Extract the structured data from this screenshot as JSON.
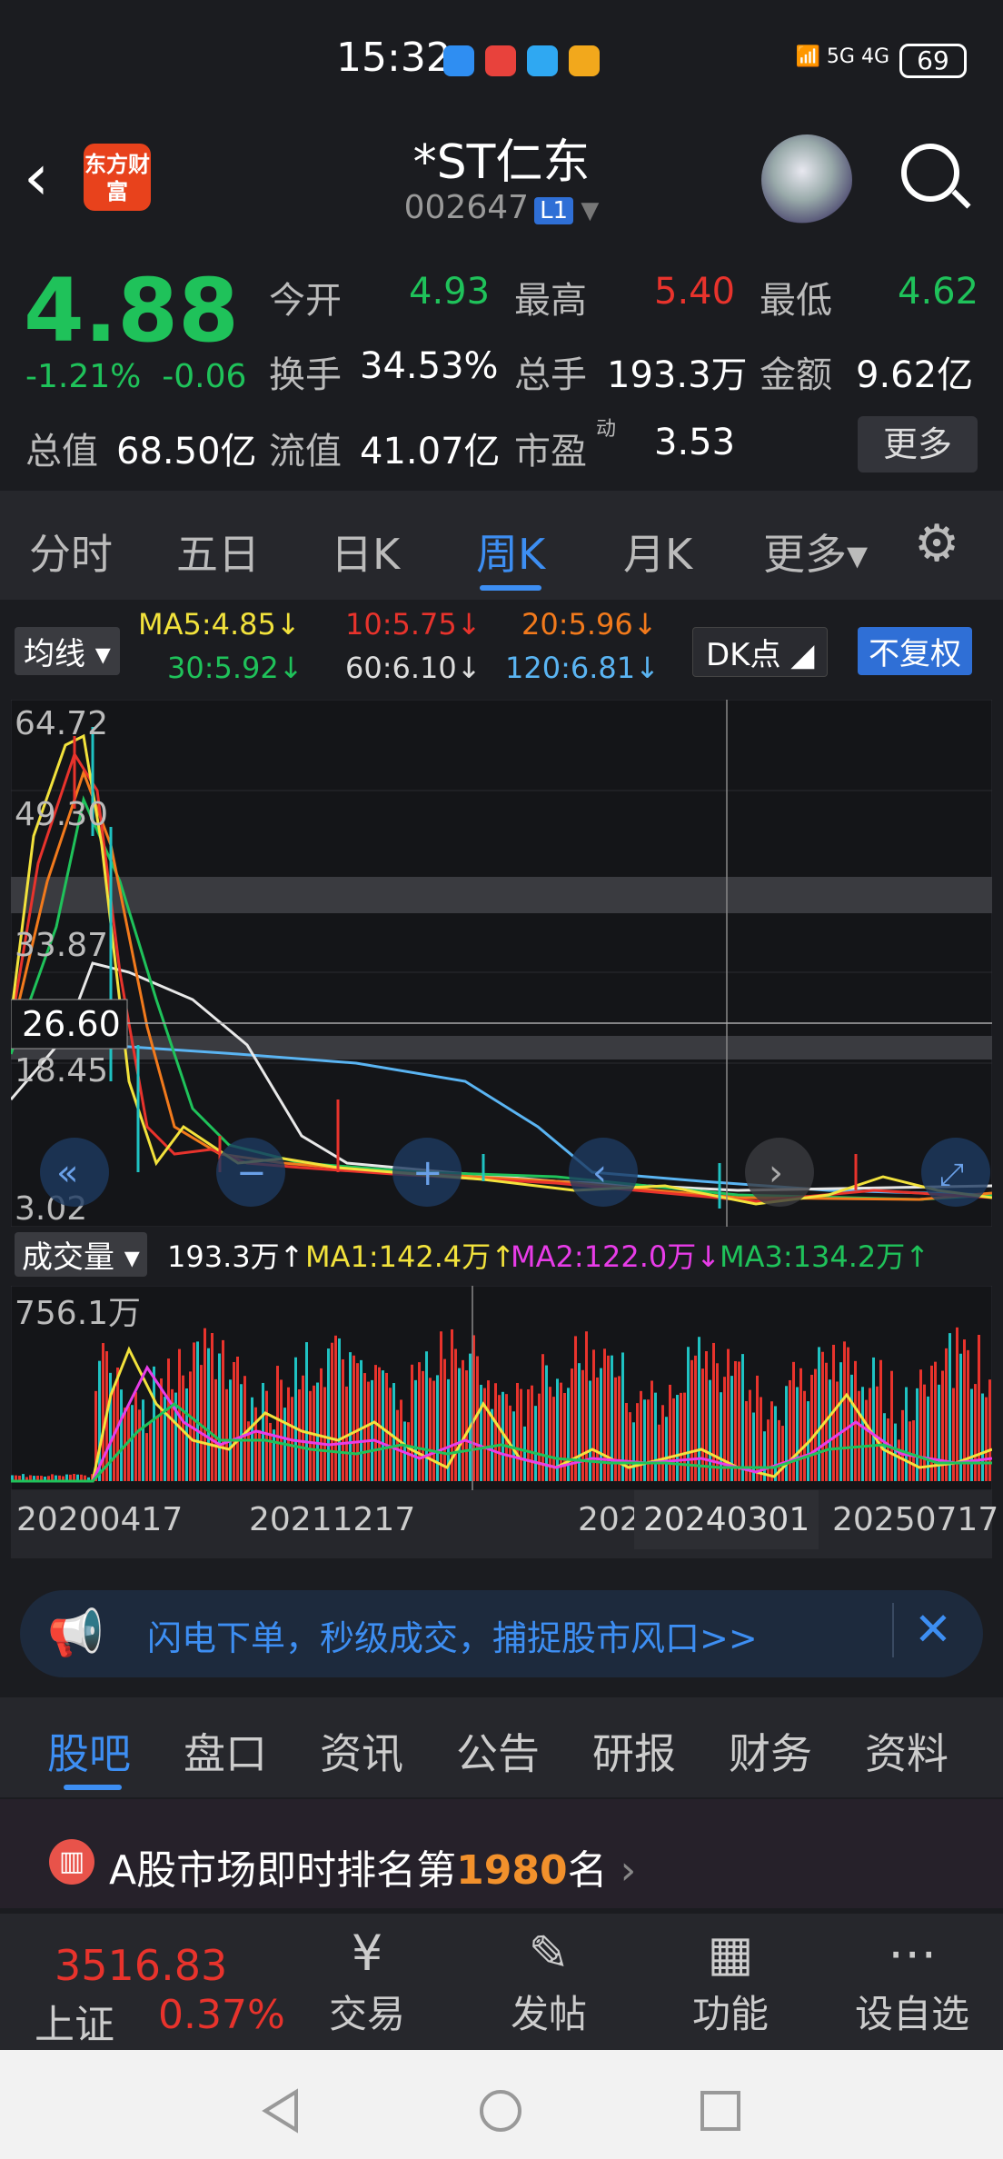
{
  "status": {
    "time": "15:32",
    "battery": "69",
    "net": "5G 4G"
  },
  "header": {
    "title": "*ST仁东",
    "code": "002647",
    "level": "L1",
    "logo": "东方财富"
  },
  "quote": {
    "price": "4.88",
    "pct": "-1.21%",
    "chg": "-0.06",
    "open_l": "今开",
    "open": "4.93",
    "high_l": "最高",
    "high": "5.40",
    "low_l": "最低",
    "low": "4.62",
    "turn_l": "换手",
    "turn": "34.53%",
    "vol_l": "总手",
    "vol": "193.3万",
    "amt_l": "金额",
    "amt": "9.62亿",
    "mcap_l": "总值",
    "mcap": "68.50亿",
    "fcap_l": "流值",
    "fcap": "41.07亿",
    "pe_l": "市盈",
    "pe_sup": "动",
    "pe": "3.53",
    "more": "更多"
  },
  "ktabs": [
    "分时",
    "五日",
    "日K",
    "周K",
    "月K",
    "更多▾"
  ],
  "ma": {
    "junxian": "均线",
    "ma5": "MA5:4.85↓",
    "ma10": "10:5.75↓",
    "ma20": "20:5.96↓",
    "ma30": "30:5.92↓",
    "ma60": "60:6.10↓",
    "ma120": "120:6.81↓",
    "dk": "DK点",
    "fuquan": "不复权"
  },
  "axis": {
    "y1": "64.72",
    "y2": "49.30",
    "y3": "33.87",
    "y4": "18.45",
    "y5": "3.02",
    "cursor": "26.60",
    "vmax": "756.1万"
  },
  "volume": {
    "label": "成交量",
    "v": "193.3万↑",
    "ma1": "MA1:142.4万↑",
    "ma2": "MA2:122.0万↓",
    "ma3": "MA3:134.2万↑"
  },
  "dates": {
    "d1": "20200417",
    "d2": "20211217",
    "d3": "202",
    "d4": "20240301",
    "d5": "20250717"
  },
  "banner": "闪电下单，秒级成交，捕捉股市风口>>",
  "ftabs": [
    "股吧",
    "盘口",
    "资讯",
    "公告",
    "研报",
    "财务",
    "资料"
  ],
  "rank": {
    "pre": "A股市场即时排名第",
    "num": "1980",
    "post": "名"
  },
  "index": {
    "value": "3516.83",
    "name": "上证",
    "pct": "0.37%"
  },
  "bnav": [
    "交易",
    "发帖",
    "功能",
    "设自选"
  ]
}
